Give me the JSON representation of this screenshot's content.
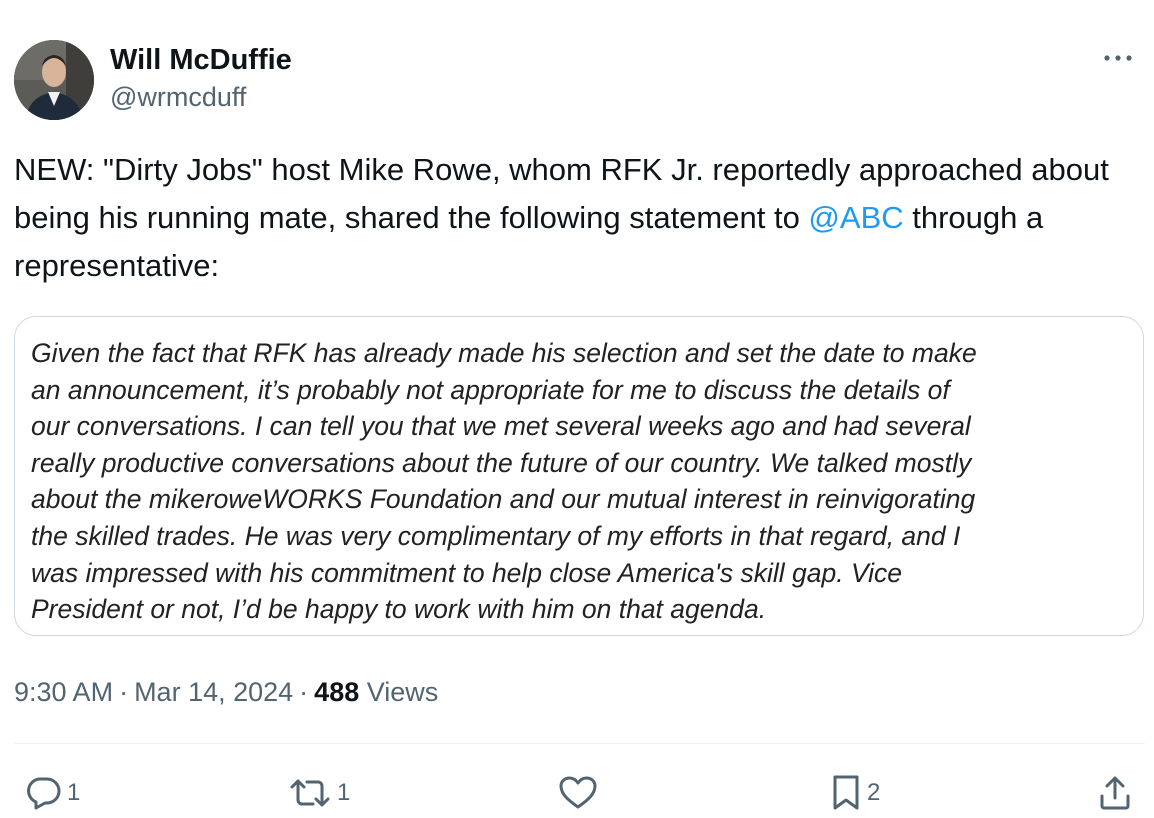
{
  "tweet": {
    "author": {
      "display_name": "Will McDuffie",
      "handle": "@wrmcduff",
      "avatar_icon": "profile-photo"
    },
    "text": {
      "part1": "NEW: \"Dirty Jobs\" host Mike Rowe, whom RFK Jr. reportedly approached about being his running mate, shared the following statement to ",
      "mention": "@ABC",
      "part2": " through a representative:"
    },
    "quote_image_text": "Given the fact that RFK has already made his selection and set the date to make\nan announcement, it’s probably not appropriate for me to discuss the details of\nour conversations. I can tell you that we met several weeks ago and had several\nreally productive conversations about the future of our country. We talked mostly\nabout the mikeroweWORKS Foundation and our mutual interest in reinvigorating\nthe skilled trades. He was very complimentary of my efforts in that regard, and I\nwas impressed with his commitment to help close America's skill gap. Vice\nPresident or not, I’d be happy to work with him on that agenda.",
    "meta": {
      "time": "9:30 AM",
      "separator": "·",
      "date": "Mar 14, 2024",
      "views_count": "488",
      "views_label": "Views"
    },
    "actions": {
      "replies": "1",
      "reposts": "1",
      "likes": "",
      "bookmarks": "2"
    }
  },
  "colors": {
    "text_primary": "#0f1419",
    "text_secondary": "#536471",
    "link": "#1d9bf0",
    "border": "#cfd9de"
  },
  "icons": {
    "more": "more-dots-icon",
    "reply": "reply-icon",
    "repost": "repost-icon",
    "like": "heart-icon",
    "bookmark": "bookmark-icon",
    "share": "share-icon"
  }
}
